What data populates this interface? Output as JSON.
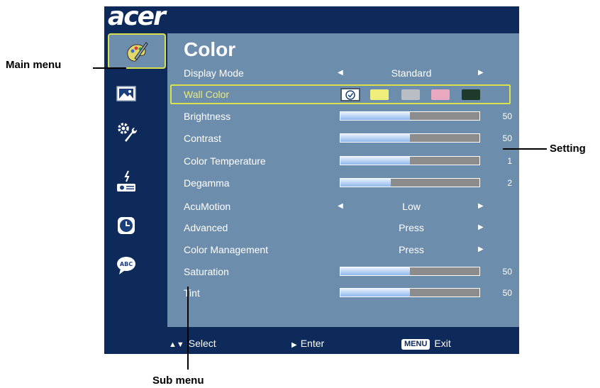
{
  "brand": "acer",
  "sidebar": {
    "icons": [
      "color-palette-icon",
      "image-icon",
      "settings-icon",
      "projector-icon",
      "clock-icon",
      "language-icon"
    ]
  },
  "menu": {
    "title": "Color",
    "display_mode": {
      "label": "Display Mode",
      "value": "Standard"
    },
    "wall_color": {
      "label": "Wall Color",
      "swatches": [
        "#f0ee7a",
        "#b8bec4",
        "#e8a8c0",
        "#1e3a2a"
      ]
    },
    "brightness": {
      "label": "Brightness",
      "value": "50",
      "level": 0.5
    },
    "contrast": {
      "label": "Contrast",
      "value": "50",
      "level": 0.5
    },
    "color_temperature": {
      "label": "Color Temperature",
      "value": "1",
      "level": 0.5
    },
    "degamma": {
      "label": "Degamma",
      "value": "2",
      "level": 0.36
    },
    "acumotion": {
      "label": "AcuMotion",
      "value": "Low"
    },
    "advanced": {
      "label": "Advanced",
      "value": "Press"
    },
    "color_management": {
      "label": "Color Management",
      "value": "Press"
    },
    "saturation": {
      "label": "Saturation",
      "value": "50",
      "level": 0.5
    },
    "tint": {
      "label": "Tint",
      "value": "50",
      "level": 0.5
    }
  },
  "footer": {
    "select": "Select",
    "enter": "Enter",
    "menu_key": "MENU",
    "exit": "Exit"
  },
  "callouts": {
    "main_menu": "Main menu",
    "setting": "Setting",
    "sub_menu": "Sub menu"
  },
  "colors": {
    "frame": "#0d2a5a",
    "panel": "#6d8dad",
    "highlight": "#d9e24a"
  }
}
